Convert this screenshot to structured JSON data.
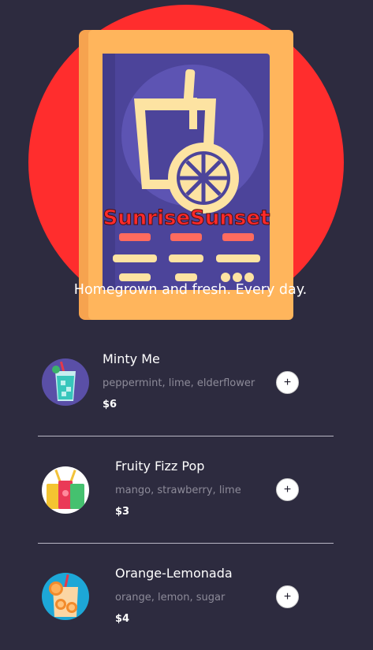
{
  "brand": {
    "name": "SunriseSunset",
    "tagline": "Homegrown and fresh. Every day."
  },
  "colors": {
    "background": "#2d2b3f",
    "brand_text": "#ff2a2a",
    "accent_circle": "#ff2d2d"
  },
  "menu": {
    "items": [
      {
        "name": "Minty Me",
        "ingredients": "peppermint, lime, elderflower",
        "price": "$6",
        "add_label": "+",
        "icon": "minty-drink-icon"
      },
      {
        "name": "Fruity Fizz Pop",
        "ingredients": "mango, strawberry, lime",
        "price": "$3",
        "add_label": "+",
        "icon": "fruity-drinks-icon"
      },
      {
        "name": "Orange-Lemonada",
        "ingredients": "orange, lemon, sugar",
        "price": "$4",
        "add_label": "+",
        "icon": "orange-lemonade-icon"
      }
    ]
  }
}
